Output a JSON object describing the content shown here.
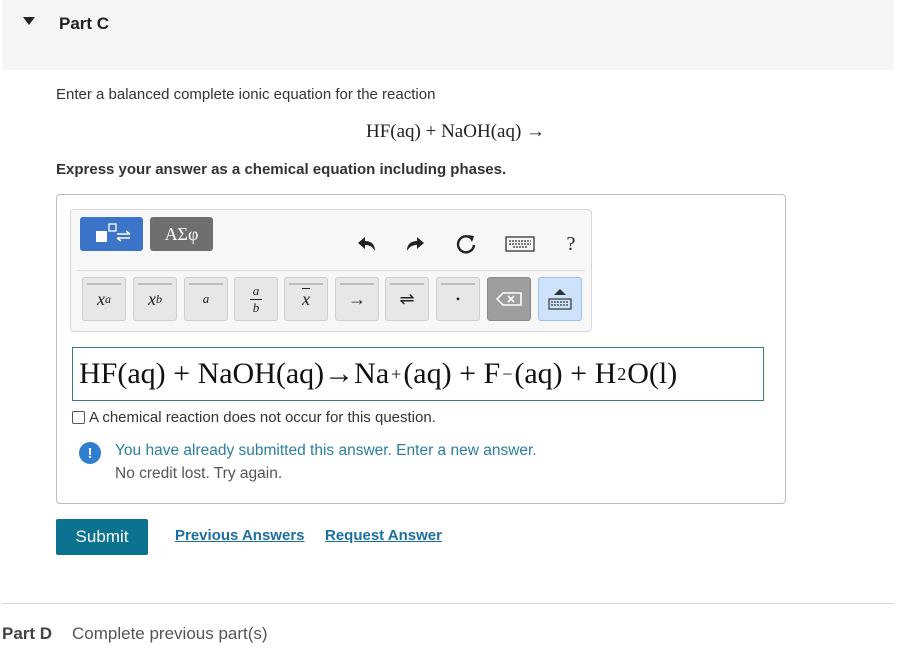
{
  "part": {
    "title": "Part C"
  },
  "question": {
    "prompt": "Enter a balanced complete ionic equation for the reaction",
    "reaction": "HF(aq) + NaOH(aq) →",
    "instruction": "Express your answer as a chemical equation including phases."
  },
  "toolbar": {
    "greek_label": "ΑΣφ",
    "help_label": "?",
    "keys": {
      "superscript": "x",
      "superscript_sup": "a",
      "subscript": "x",
      "subscript_sub": "b",
      "vec_a": "a",
      "frac_num": "a",
      "frac_den": "b",
      "bar_x": "x",
      "arrow": "→",
      "equilibrium": "⇌",
      "dot": "•"
    }
  },
  "answer": {
    "part1": "HF(aq) + NaOH(aq)→Na",
    "sup1": "+",
    "part2": "(aq) + F",
    "sup2": "−",
    "part3": "(aq) + H",
    "sub1": "2",
    "part4": "O(l)"
  },
  "no_reaction_label": "A chemical reaction does not occur for this question.",
  "alert": {
    "icon": "!",
    "line1": "You have already submitted this answer. Enter a new answer.",
    "line2": "No credit lost. Try again."
  },
  "actions": {
    "submit": "Submit",
    "previous_answers": "Previous Answers",
    "request_answer": "Request Answer"
  },
  "next_part": {
    "label": "Part D",
    "status": "Complete previous part(s)"
  },
  "colors": {
    "header_bg": "#f5f5f5",
    "submit_bg": "#0b7290",
    "link": "#1d6fa0",
    "alert_text": "#2a7fa0",
    "input_border": "#3a7a8a"
  }
}
